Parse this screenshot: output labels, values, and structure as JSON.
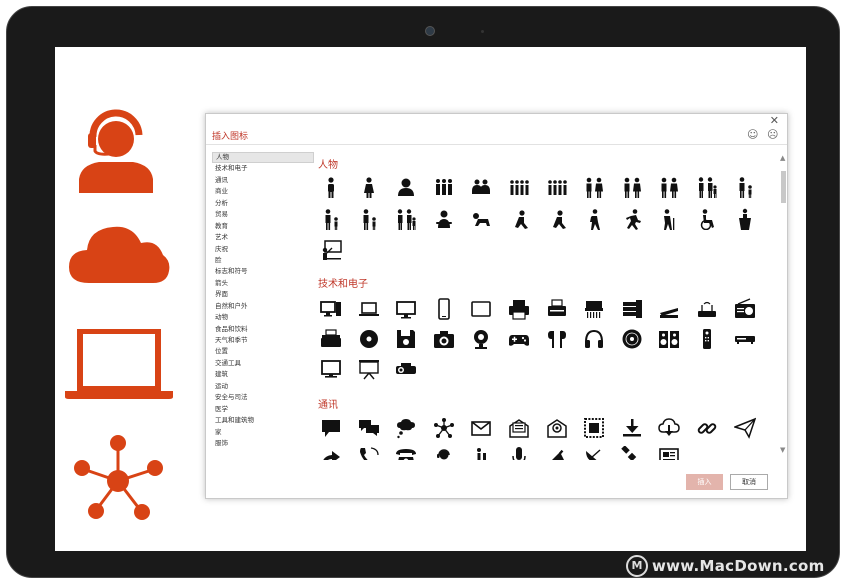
{
  "dialog": {
    "title": "插入图标",
    "close": "✕",
    "face_happy": "☺",
    "face_sad": "☹",
    "insert_label": "插入",
    "cancel_label": "取消"
  },
  "categories": [
    "人物",
    "技术和电子",
    "通讯",
    "商业",
    "分析",
    "贸易",
    "教育",
    "艺术",
    "庆祝",
    "脸",
    "标志和符号",
    "箭头",
    "界面",
    "自然和户外",
    "动物",
    "食品和饮料",
    "天气和季节",
    "位置",
    "交通工具",
    "建筑",
    "运动",
    "安全与司法",
    "医学",
    "工具和建筑物",
    "家",
    "服饰"
  ],
  "sections": [
    {
      "title": "人物"
    },
    {
      "title": "技术和电子"
    },
    {
      "title": "通讯"
    }
  ],
  "scrollbar": {
    "up": "▲",
    "down": "▼"
  },
  "watermark": {
    "logo": "M",
    "text": "www.MacDown.com"
  },
  "colors": {
    "accent": "#d84315",
    "dialog_title": "#c0392b",
    "insert_bg": "#e3b4ac"
  }
}
